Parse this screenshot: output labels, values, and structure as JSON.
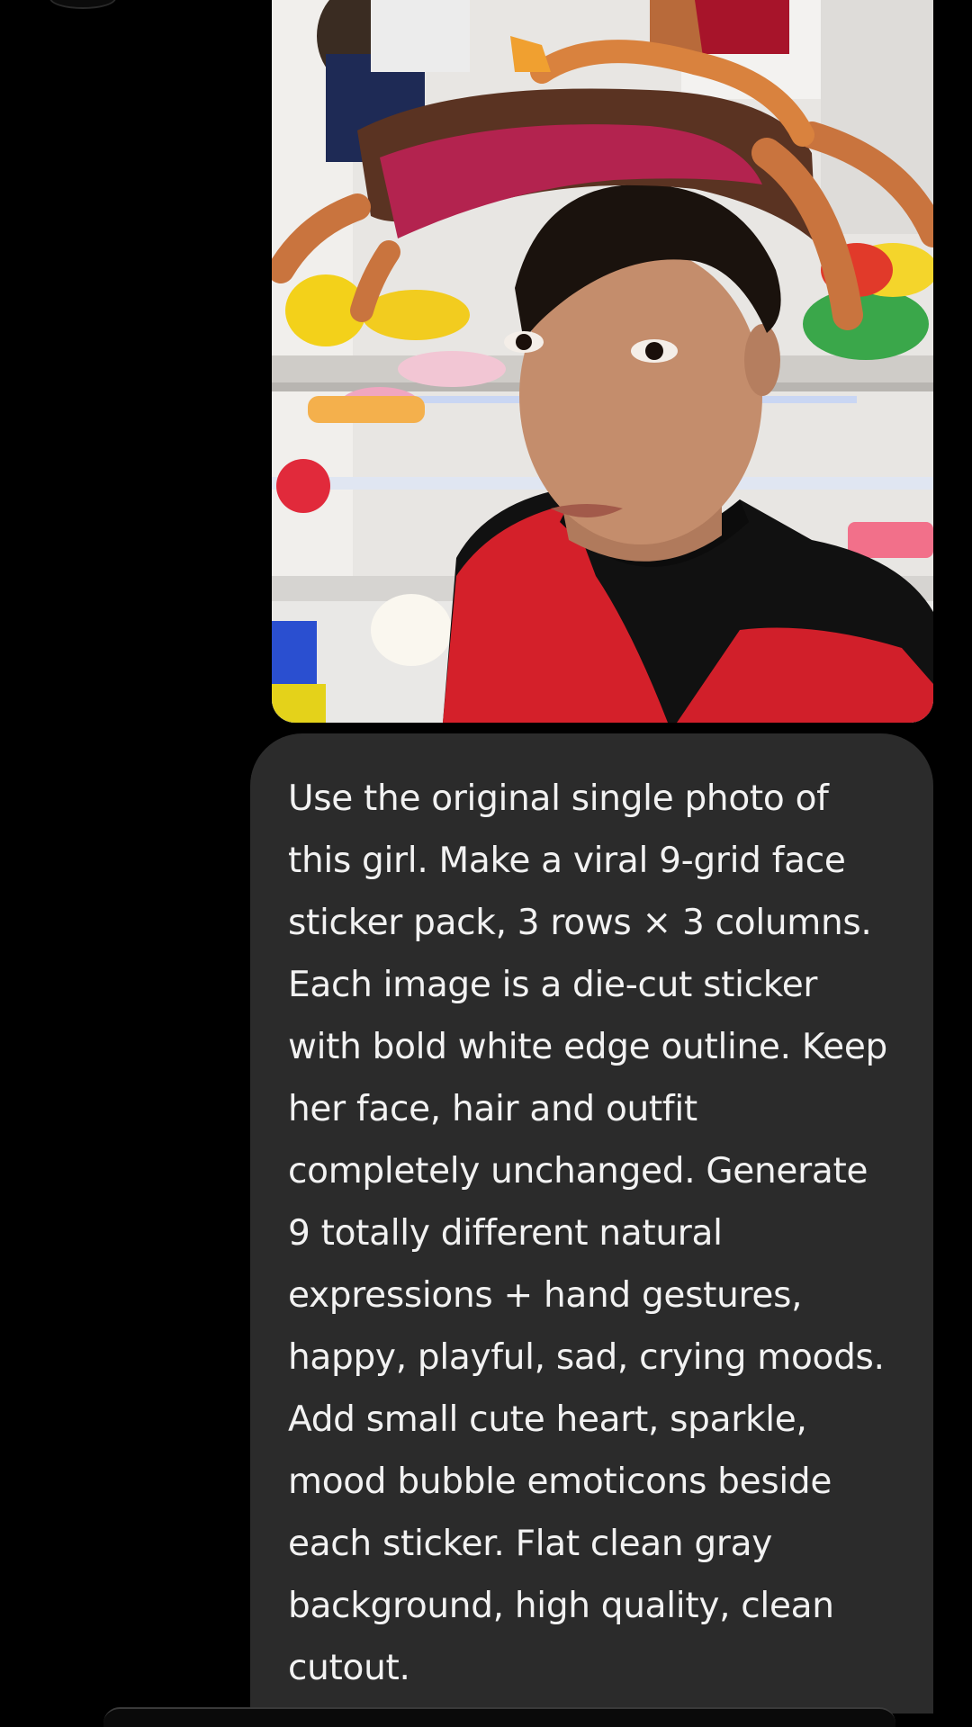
{
  "colors": {
    "background": "#000000",
    "bubble": "#2b2b2b",
    "text": "#f2f2f2"
  },
  "photo": {
    "icon": "image-icon"
  },
  "message": {
    "text": "Use the original single photo of this girl. Make a viral 9-grid face sticker pack, 3 rows × 3 columns. Each image is a die-cut sticker with bold white edge outline. Keep her face, hair and outfit completely unchanged. Generate 9 totally different natural expressions + hand gestures, happy, playful, sad, crying moods. Add small cute heart, sparkle, mood bubble emoticons beside each sticker. Flat clean gray background, high quality, clean cutout."
  }
}
